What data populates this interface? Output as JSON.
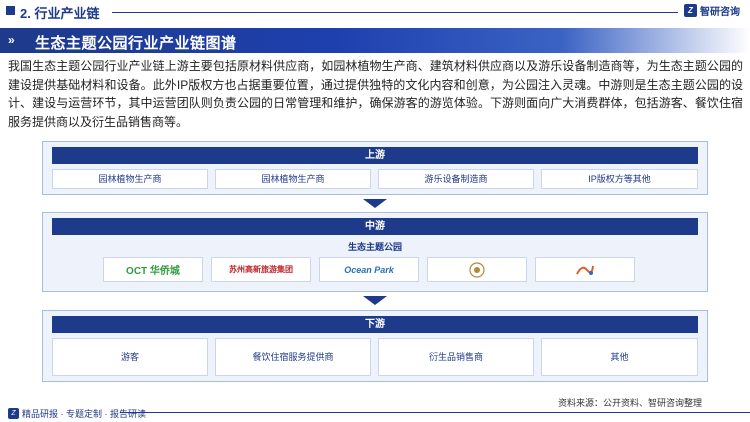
{
  "header": {
    "section_title": "2. 行业产业链",
    "brand": "智研咨询",
    "brand_mark": "Z"
  },
  "banner": {
    "title": "生态主题公园行业产业链图谱"
  },
  "intro": {
    "paragraph": "我国生态主题公园行业产业链上游主要包括原材料供应商，如园林植物生产商、建筑材料供应商以及游乐设备制造商等，为生态主题公园的建设提供基础材料和设备。此外IP版权方也占据重要位置，通过提供独特的文化内容和创意，为公园注入灵魂。中游则是生态主题公园的设计、建设与运营环节，其中运营团队则负责公园的日常管理和维护，确保游客的游览体验。下游则面向广大消费群体，包括游客、餐饮住宿服务提供商以及衍生品销售商等。"
  },
  "upstream": {
    "header": "上游",
    "items": [
      "园林植物生产商",
      "园林植物生产商",
      "游乐设备制造商",
      "IP版权方等其他"
    ]
  },
  "midstream": {
    "header": "中游",
    "subtitle": "生态主题公园",
    "logos": [
      {
        "text": "OCT 华侨城",
        "color": "#2e9d3f"
      },
      {
        "text": "苏州高新旅游集团",
        "color": "#c0272d"
      },
      {
        "text": "Ocean Park",
        "color": "#2a6fb5"
      },
      {
        "text": "",
        "color": "#b08a3e"
      },
      {
        "text": "",
        "color": "#e05a2a"
      }
    ]
  },
  "downstream": {
    "header": "下游",
    "items": [
      "游客",
      "餐饮住宿服务提供商",
      "衍生品销售商",
      "其他"
    ]
  },
  "footer": {
    "left": "精品研报 · 专题定制 · 报告研读",
    "source": "资料来源：公开资料、智研咨询整理"
  },
  "colors": {
    "primary": "#1e3a8a",
    "panel_bg": "#eef3fb",
    "panel_border": "#a8bede"
  }
}
